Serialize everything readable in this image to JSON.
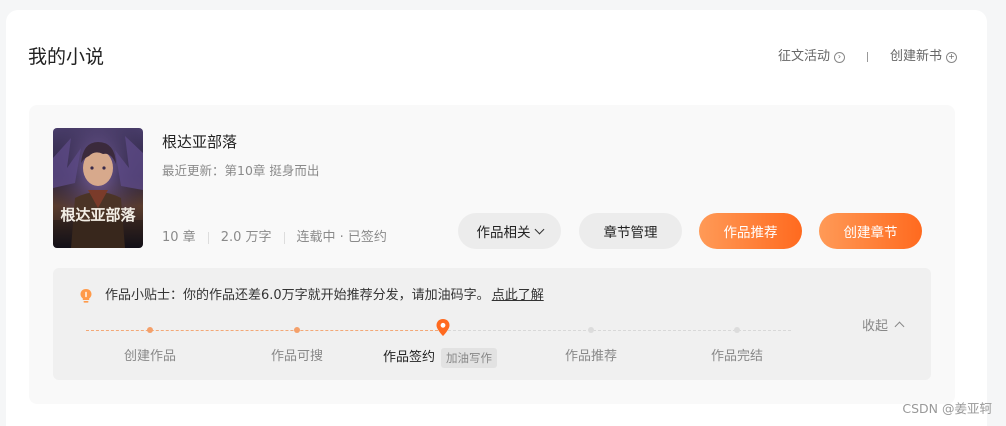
{
  "page": {
    "title": "我的小说",
    "watermark": "CSDN @姜亚轲"
  },
  "header": {
    "contest": {
      "label": "征文活动",
      "icon": "circle-arrow-right-icon"
    },
    "create_book": {
      "label": "创建新书",
      "icon": "circle-plus-icon"
    }
  },
  "book": {
    "title": "根达亚部落",
    "cover_text": "根达亚部落",
    "last_update": "最近更新：第10章 挺身而出",
    "chapters": "10 章",
    "words": "2.0 万字",
    "status": "连载中 · 已签约"
  },
  "actions": {
    "related": "作品相关",
    "chapter_manage": "章节管理",
    "recommend": "作品推荐",
    "create_chapter": "创建章节"
  },
  "tips": {
    "text": "作品小贴士：你的作品还差6.0万字就开始推荐分发，请加油码字。",
    "link": "点此了解",
    "collapse": "收起",
    "current_step_index": 2,
    "steps": [
      {
        "label": "创建作品"
      },
      {
        "label": "作品可搜"
      },
      {
        "label": "作品签约",
        "badge": "加油写作"
      },
      {
        "label": "作品推荐"
      },
      {
        "label": "作品完结"
      }
    ]
  },
  "colors": {
    "accent": "#ff6a1f",
    "accent_light": "#ff9a57"
  }
}
